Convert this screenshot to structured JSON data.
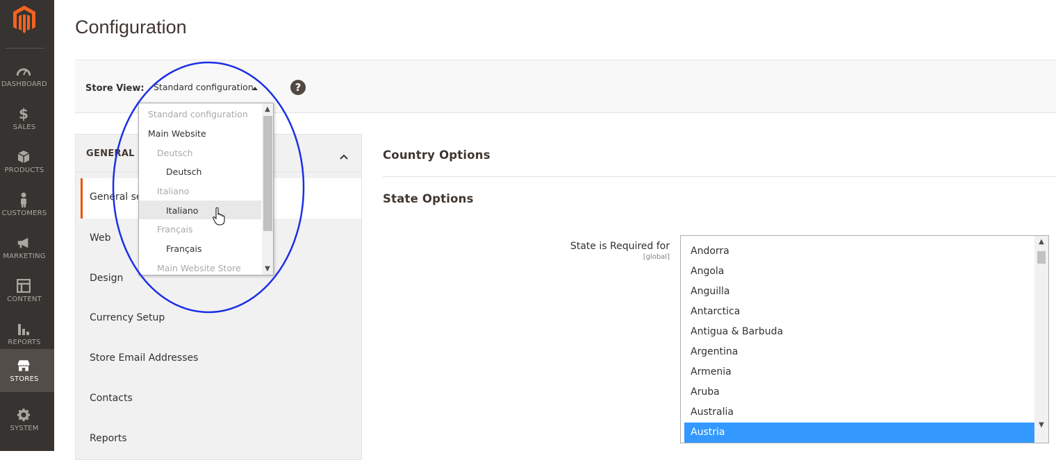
{
  "nav": {
    "items": [
      {
        "label": "DASHBOARD",
        "icon": "dashboard-icon"
      },
      {
        "label": "SALES",
        "icon": "dollar-icon"
      },
      {
        "label": "PRODUCTS",
        "icon": "box-icon"
      },
      {
        "label": "CUSTOMERS",
        "icon": "person-icon"
      },
      {
        "label": "MARKETING",
        "icon": "megaphone-icon"
      },
      {
        "label": "CONTENT",
        "icon": "layout-icon"
      },
      {
        "label": "REPORTS",
        "icon": "bar-chart-icon"
      },
      {
        "label": "STORES",
        "icon": "storefront-icon"
      },
      {
        "label": "SYSTEM",
        "icon": "gear-icon"
      }
    ],
    "active": "STORES"
  },
  "page": {
    "title": "Configuration"
  },
  "scope": {
    "label": "Store View:",
    "selected": "Standard configuration",
    "help": "?"
  },
  "dropdown": {
    "options": [
      {
        "label": "Standard configuration",
        "disabled": true
      },
      {
        "label": "Main Website",
        "disabled": false
      },
      {
        "label": "Deutsch",
        "disabled": true
      },
      {
        "label": "Deutsch",
        "disabled": false
      },
      {
        "label": "Italiano",
        "disabled": true
      },
      {
        "label": "Italiano",
        "disabled": false,
        "hover": true
      },
      {
        "label": "Français",
        "disabled": true
      },
      {
        "label": "Français",
        "disabled": false
      },
      {
        "label": "Main Website Store",
        "disabled": true
      }
    ]
  },
  "tabs": {
    "title": "GENERAL S",
    "items": [
      "General se",
      "Web",
      "Design",
      "Currency Setup",
      "Store Email Addresses",
      "Contacts",
      "Reports"
    ]
  },
  "content": {
    "sections": [
      "Country Options",
      "State Options"
    ],
    "field_label": "State is Required for",
    "field_scope": "[global]",
    "countries": [
      "Andorra",
      "Angola",
      "Anguilla",
      "Antarctica",
      "Antigua & Barbuda",
      "Argentina",
      "Armenia",
      "Aruba",
      "Australia",
      "Austria"
    ],
    "selected_country": "Austria"
  },
  "colors": {
    "nav_bg": "#373330",
    "accent": "#eb5202",
    "selection": "#3399ff",
    "annotation": "#1a2ee6"
  }
}
